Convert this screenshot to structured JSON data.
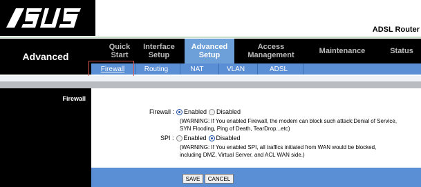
{
  "header": {
    "logo_text": "ASUS",
    "router_title": "ADSL Router"
  },
  "nav": {
    "section_title": "Advanced",
    "items": [
      {
        "line1": "Quick",
        "line2": "Start"
      },
      {
        "line1": "Interface",
        "line2": "Setup"
      },
      {
        "line1": "Advanced",
        "line2": "Setup"
      },
      {
        "line1": "Access",
        "line2": "Management"
      },
      {
        "line1": "Maintenance",
        "line2": ""
      },
      {
        "line1": "Status",
        "line2": ""
      }
    ],
    "active_index": 2
  },
  "subnav": {
    "items": [
      "Firewall",
      "Routing",
      "NAT",
      "VLAN",
      "ADSL"
    ],
    "active": "Firewall"
  },
  "left_panel": {
    "label": "Firewall"
  },
  "form": {
    "firewall": {
      "label": "Firewall :",
      "enabled_label": "Enabled",
      "disabled_label": "Disabled",
      "selected": "Enabled",
      "warning_line1": "(WARNING: If You enabled Firewall, the modem can block such attack:Denial of Service,",
      "warning_line2": "SYN Flooding, Ping of Death, TearDrop...etc)"
    },
    "spi": {
      "label": "SPI :",
      "enabled_label": "Enabled",
      "disabled_label": "Disabled",
      "selected": "Disabled",
      "warning_line1": "(WARNING: If You enabled SPI, all traffics initiated from WAN would be blocked,",
      "warning_line2": "including DMZ, Virtual Server, and ACL WAN side.)"
    }
  },
  "buttons": {
    "save": "SAVE",
    "cancel": "CANCEL"
  },
  "colors": {
    "nav_active": "#6d9fd8",
    "subnav": "#5b8fd5",
    "highlight": "#d9534f"
  }
}
